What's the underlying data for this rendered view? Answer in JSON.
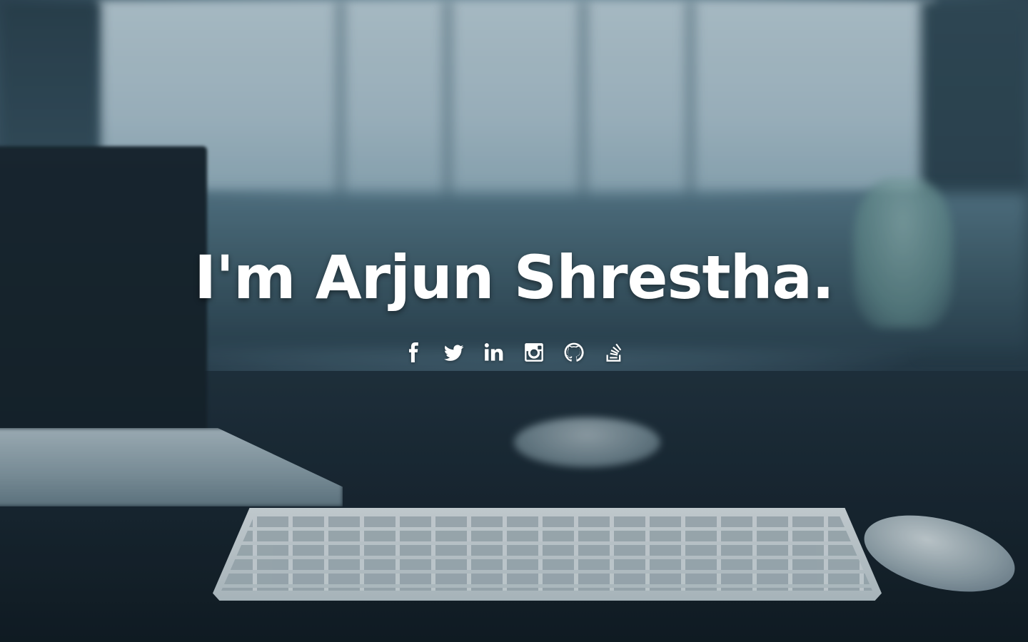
{
  "hero": {
    "headline": "I'm Arjun Shrestha."
  },
  "social_links": [
    {
      "name": "facebook",
      "icon": "facebook-icon"
    },
    {
      "name": "twitter",
      "icon": "twitter-icon"
    },
    {
      "name": "linkedin",
      "icon": "linkedin-icon"
    },
    {
      "name": "instagram",
      "icon": "instagram-icon"
    },
    {
      "name": "github",
      "icon": "github-icon"
    },
    {
      "name": "stackoverflow",
      "icon": "stackoverflow-icon"
    }
  ],
  "colors": {
    "text": "#ffffff",
    "desk": "#1b2935",
    "window_light": "#c8dbe5"
  }
}
